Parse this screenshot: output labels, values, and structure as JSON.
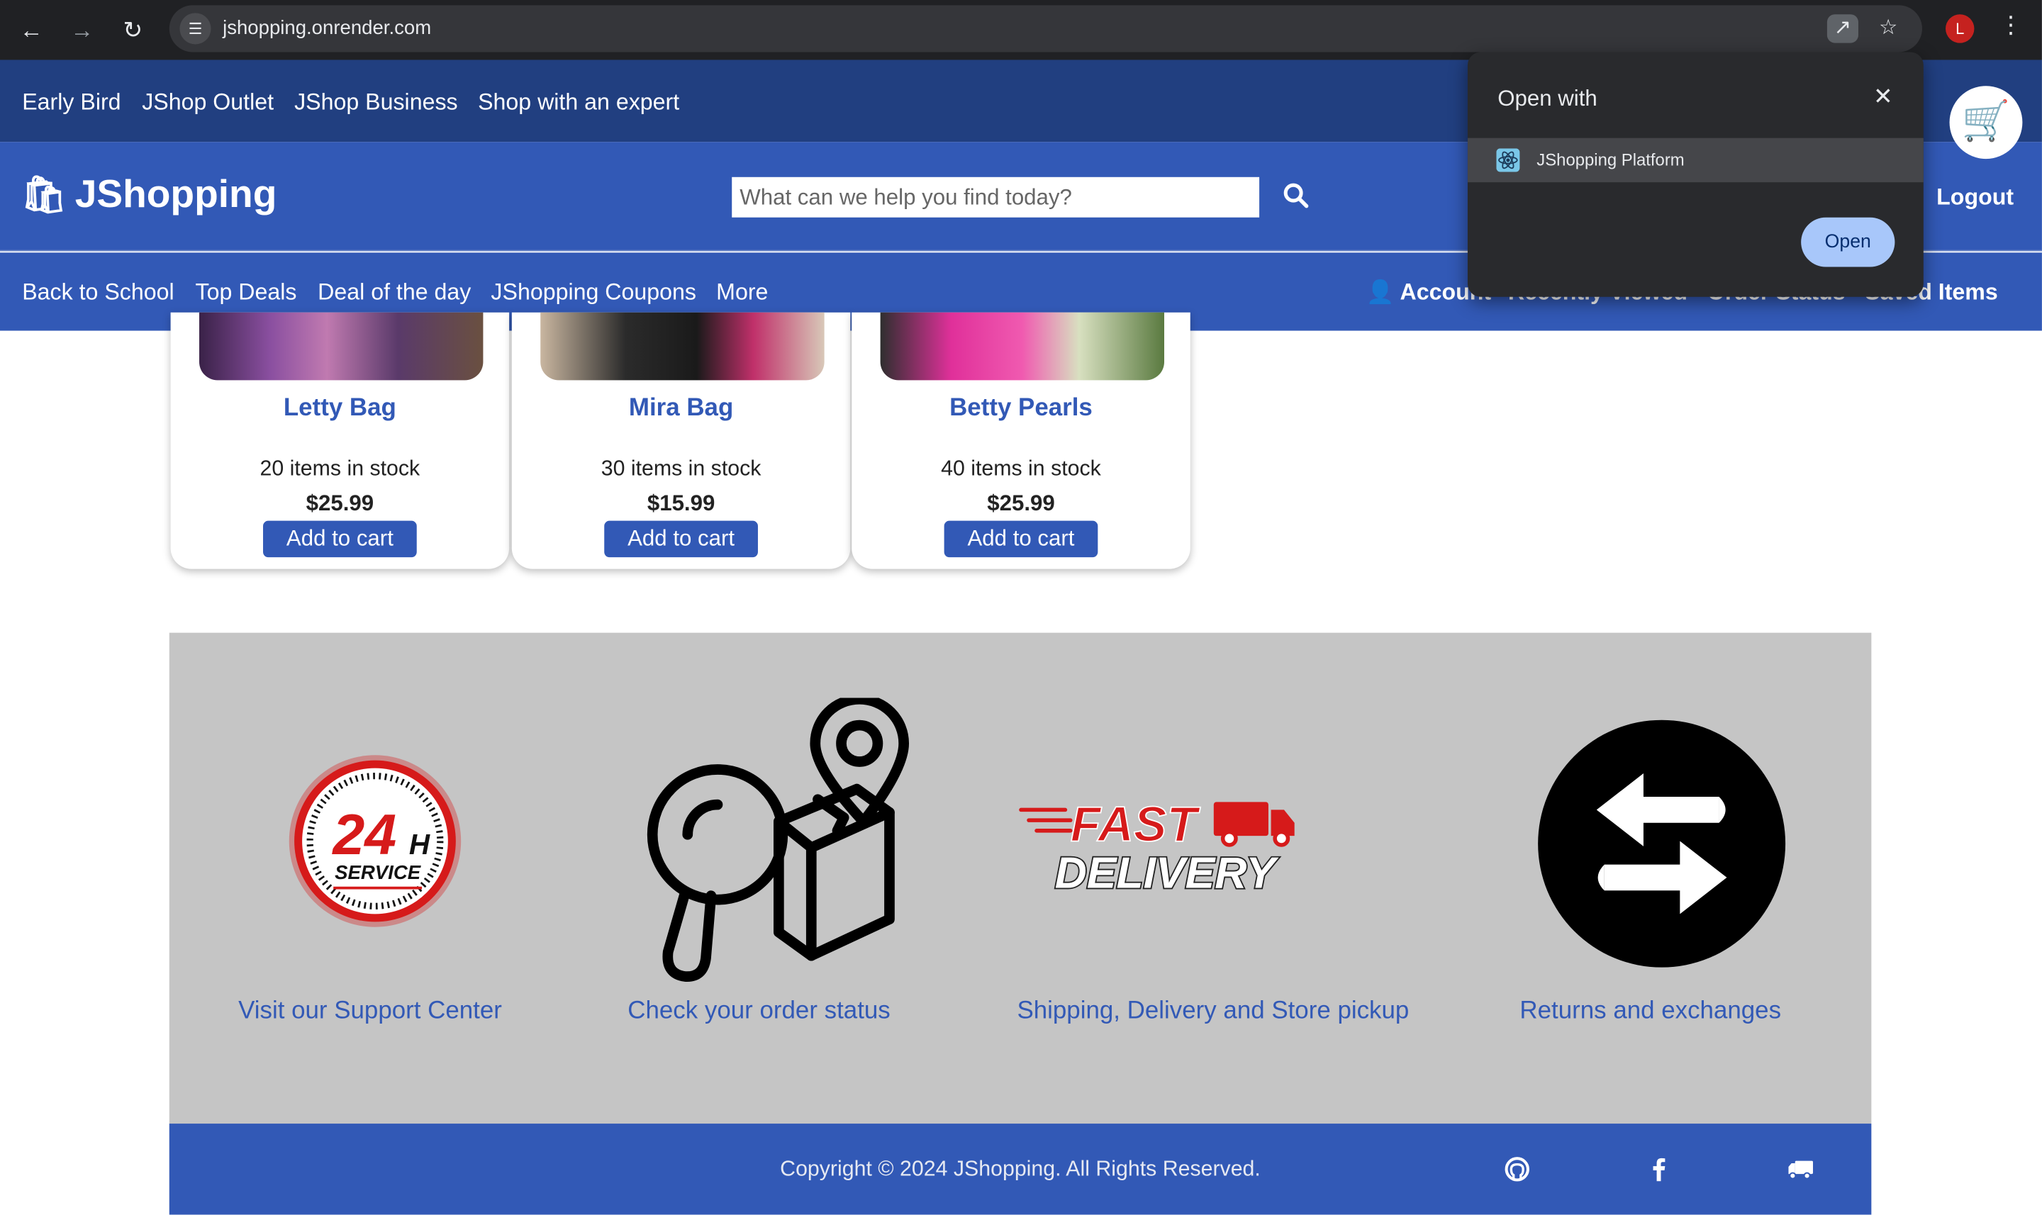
{
  "browser": {
    "url": "jshopping.onrender.com",
    "profile_initial": "L",
    "icons": [
      "back-arrow-icon",
      "forward-arrow-icon",
      "reload-icon",
      "site-settings-icon",
      "open-in-app-icon",
      "bookmark-star-icon",
      "menu-kebab-icon"
    ]
  },
  "topbar": {
    "links": [
      "Early Bird",
      "JShop Outlet",
      "JShop Business",
      "Shop with an expert"
    ]
  },
  "header": {
    "brand": "JShopping",
    "search_placeholder": "What can we help you find today?",
    "logout": "Logout"
  },
  "subnav": {
    "links": [
      "Back to School",
      "Top Deals",
      "Deal of the day",
      "JShopping Coupons",
      "More"
    ],
    "account": "Account",
    "recently_viewed": "Recently Viewed",
    "order_status": "Order Status",
    "saved_items": "Saved Items"
  },
  "products": [
    {
      "name": "Letty Bag",
      "stock": "20 items in stock",
      "price": "$25.99",
      "button": "Add to cart"
    },
    {
      "name": "Mira Bag",
      "stock": "30 items in stock",
      "price": "$15.99",
      "button": "Add to cart"
    },
    {
      "name": "Betty Pearls",
      "stock": "40 items in stock",
      "price": "$25.99",
      "button": "Add to cart"
    }
  ],
  "services": {
    "support": "Visit our Support Center",
    "order_status": "Check your order status",
    "shipping": "Shipping, Delivery and Store pickup",
    "returns": "Returns and exchanges",
    "badge_24h": "24",
    "badge_h": "H",
    "badge_service": "SERVICE",
    "fast": "FAST",
    "delivery": "DELIVERY"
  },
  "footer": {
    "copyright": "Copyright © 2024 JShopping. All Rights Reserved.",
    "icons": [
      "github-icon",
      "facebook-icon",
      "truck-icon"
    ]
  },
  "popup": {
    "title": "Open with",
    "app_name": "JShopping Platform",
    "open_button": "Open"
  },
  "colors": {
    "brand_blue": "#3259b6",
    "topbar_navy": "#213f80",
    "service_gray": "#c5c5c5"
  }
}
